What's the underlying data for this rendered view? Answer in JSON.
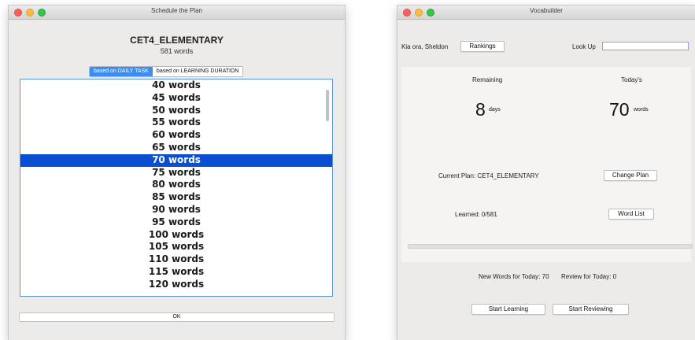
{
  "schedule_window": {
    "title": "Schedule the Plan",
    "plan_name": "CET4_ELEMENTARY",
    "word_count": "581 words",
    "mode_tabs": [
      {
        "label": "based on DAILY TASK",
        "selected": true
      },
      {
        "label": "based on LEARNING DURATION",
        "selected": false
      }
    ],
    "options": [
      "40 words",
      "45 words",
      "50 words",
      "55 words",
      "60 words",
      "65 words",
      "70 words",
      "75 words",
      "80 words",
      "85 words",
      "90 words",
      "95 words",
      "100 words",
      "105 words",
      "110 words",
      "115 words",
      "120 words"
    ],
    "selected_option": "70 words",
    "ok_label": "OK"
  },
  "vocab_window": {
    "title": "Vocabuilder",
    "greeting": "Kia ora, Sheldon",
    "rankings_label": "Rankings",
    "lookup_label": "Look Up",
    "lookup_value": "",
    "remaining_label": "Remaining",
    "remaining_value": "8",
    "remaining_unit": "days",
    "todays_label": "Today's",
    "todays_value": "70",
    "todays_unit": "words",
    "current_plan": "Current Plan: CET4_ELEMENTARY",
    "change_plan_label": "Change Plan",
    "learned": "Learned: 0/581",
    "word_list_label": "Word List",
    "learned_fraction": 0,
    "new_words_today": "New Words for Today: 70",
    "review_today": "Review for Today: 0",
    "start_learning_label": "Start Learning",
    "start_reviewing_label": "Start Reviewing"
  },
  "colors": {
    "selection": "#0a4fd1",
    "segment_on": "#3b8df2",
    "window_bg": "#ecebea"
  }
}
